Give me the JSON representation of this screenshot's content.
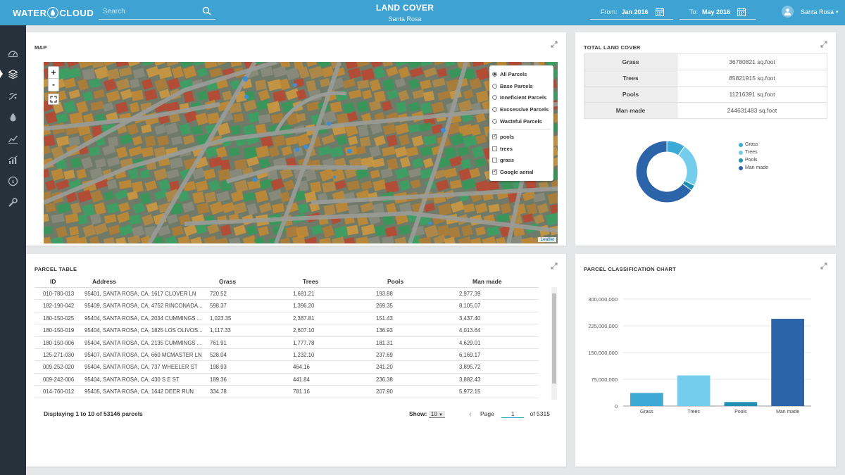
{
  "brand": {
    "logo_left": "WATER",
    "logo_right": "CLOUD"
  },
  "search": {
    "placeholder": "Search"
  },
  "header": {
    "title": "LAND COVER",
    "subtitle": "Santa Rosa"
  },
  "dates": {
    "from_label": "From:",
    "from_value": "Jan 2016",
    "to_label": "To:",
    "to_value": "May 2016"
  },
  "user": {
    "name": "Santa Rosa"
  },
  "sidebar": {
    "items": [
      {
        "icon": "dashboard-icon"
      },
      {
        "icon": "layers-icon",
        "active": true
      },
      {
        "icon": "irrigation-icon"
      },
      {
        "icon": "water-drop-icon"
      },
      {
        "icon": "trend-icon"
      },
      {
        "icon": "analytics-icon"
      },
      {
        "icon": "forecast-icon"
      },
      {
        "icon": "settings-wrench-icon"
      }
    ]
  },
  "map_panel": {
    "title": "MAP",
    "zoom_in": "+",
    "zoom_out": "-",
    "layers": {
      "base": [
        "All Parcels",
        "Base Parcels",
        "Inneficient Parcels",
        "Excsessive Parcels",
        "Wasteful Parcels"
      ],
      "overlays": [
        "pools",
        "trees",
        "grass",
        "Google aerial"
      ],
      "selected_base": "All Parcels",
      "checked_overlays": [
        "pools",
        "Google aerial"
      ]
    },
    "attribution": "Leaflet"
  },
  "totals_panel": {
    "title": "TOTAL LAND COVER",
    "rows": [
      {
        "label": "Grass",
        "value": "36780821 sq.foot"
      },
      {
        "label": "Trees",
        "value": "85821915 sq.foot"
      },
      {
        "label": "Pools",
        "value": "11216391 sq.foot"
      },
      {
        "label": "Man made",
        "value": "244631483 sq.foot"
      }
    ],
    "legend": [
      "Grass",
      "Trees",
      "Pools",
      "Man made"
    ]
  },
  "parcel_table": {
    "title": "PARCEL TABLE",
    "columns": [
      "ID",
      "Address",
      "Grass",
      "Trees",
      "Pools",
      "Man made"
    ],
    "rows": [
      [
        "010-780-013",
        "95401, SANTA ROSA, CA, 1617 CLOVER LN",
        "720.52",
        "1,681.21",
        "193.88",
        "2,977.39"
      ],
      [
        "182-190-042",
        "95409, SANTA ROSA, CA, 4752 RINCONADA...",
        "598.37",
        "1,396.20",
        "269.35",
        "8,105.07"
      ],
      [
        "180-150-025",
        "95404, SANTA ROSA, CA, 2034 CUMMINGS ...",
        "1,023.35",
        "2,387.81",
        "151.43",
        "3,437.40"
      ],
      [
        "180-150-019",
        "95404, SANTA ROSA, CA, 1825 LOS OLIVOS...",
        "1,117.33",
        "2,607.10",
        "136.93",
        "4,013.64"
      ],
      [
        "180-150-006",
        "95404, SANTA ROSA, CA, 2135 CUMMINGS ...",
        "761.91",
        "1,777.78",
        "181.31",
        "4,629.01"
      ],
      [
        "125-271-030",
        "95407, SANTA ROSA, CA, 660 MCMASTER LN",
        "528.04",
        "1,232.10",
        "237.69",
        "6,169.17"
      ],
      [
        "009-252-020",
        "95404, SANTA ROSA, CA, 737 WHEELER ST",
        "198.93",
        "464.16",
        "241.20",
        "3,895.72"
      ],
      [
        "009-242-006",
        "95404, SANTA ROSA, CA, 430 S E ST",
        "189.36",
        "441.84",
        "236.38",
        "3,882.43"
      ],
      [
        "014-760-012",
        "95405, SANTA ROSA, CA, 1642 DEER RUN",
        "334.78",
        "781.16",
        "207.90",
        "5,972.15"
      ]
    ],
    "footer": {
      "summary": "Displaying 1 to 10 of 53146 parcels",
      "show_label": "Show:",
      "show_value": "10",
      "page_label": "Page",
      "page_value": "1",
      "page_total": "of 5315"
    }
  },
  "class_chart_panel": {
    "title": "PARCEL CLASSIFICATION CHART"
  },
  "colors": {
    "grass": "#3fa9d6",
    "trees": "#75cdee",
    "pools": "#1f8fb3",
    "man_made": "#2b64a8"
  },
  "chart_data": [
    {
      "type": "pie",
      "categories": [
        "Grass",
        "Trees",
        "Pools",
        "Man made"
      ],
      "values": [
        36780821,
        85821915,
        11216391,
        244631483
      ],
      "donut": true,
      "legend": "right"
    },
    {
      "type": "bar",
      "categories": [
        "Grass",
        "Trees",
        "Pools",
        "Man made"
      ],
      "values": [
        36780821,
        85821915,
        11216391,
        244631483
      ],
      "ylim": [
        0,
        300000000
      ],
      "yticks": [
        "0",
        "75,000,000",
        "150,000,000",
        "225,000,000",
        "300,000,000"
      ],
      "grid": true
    }
  ]
}
